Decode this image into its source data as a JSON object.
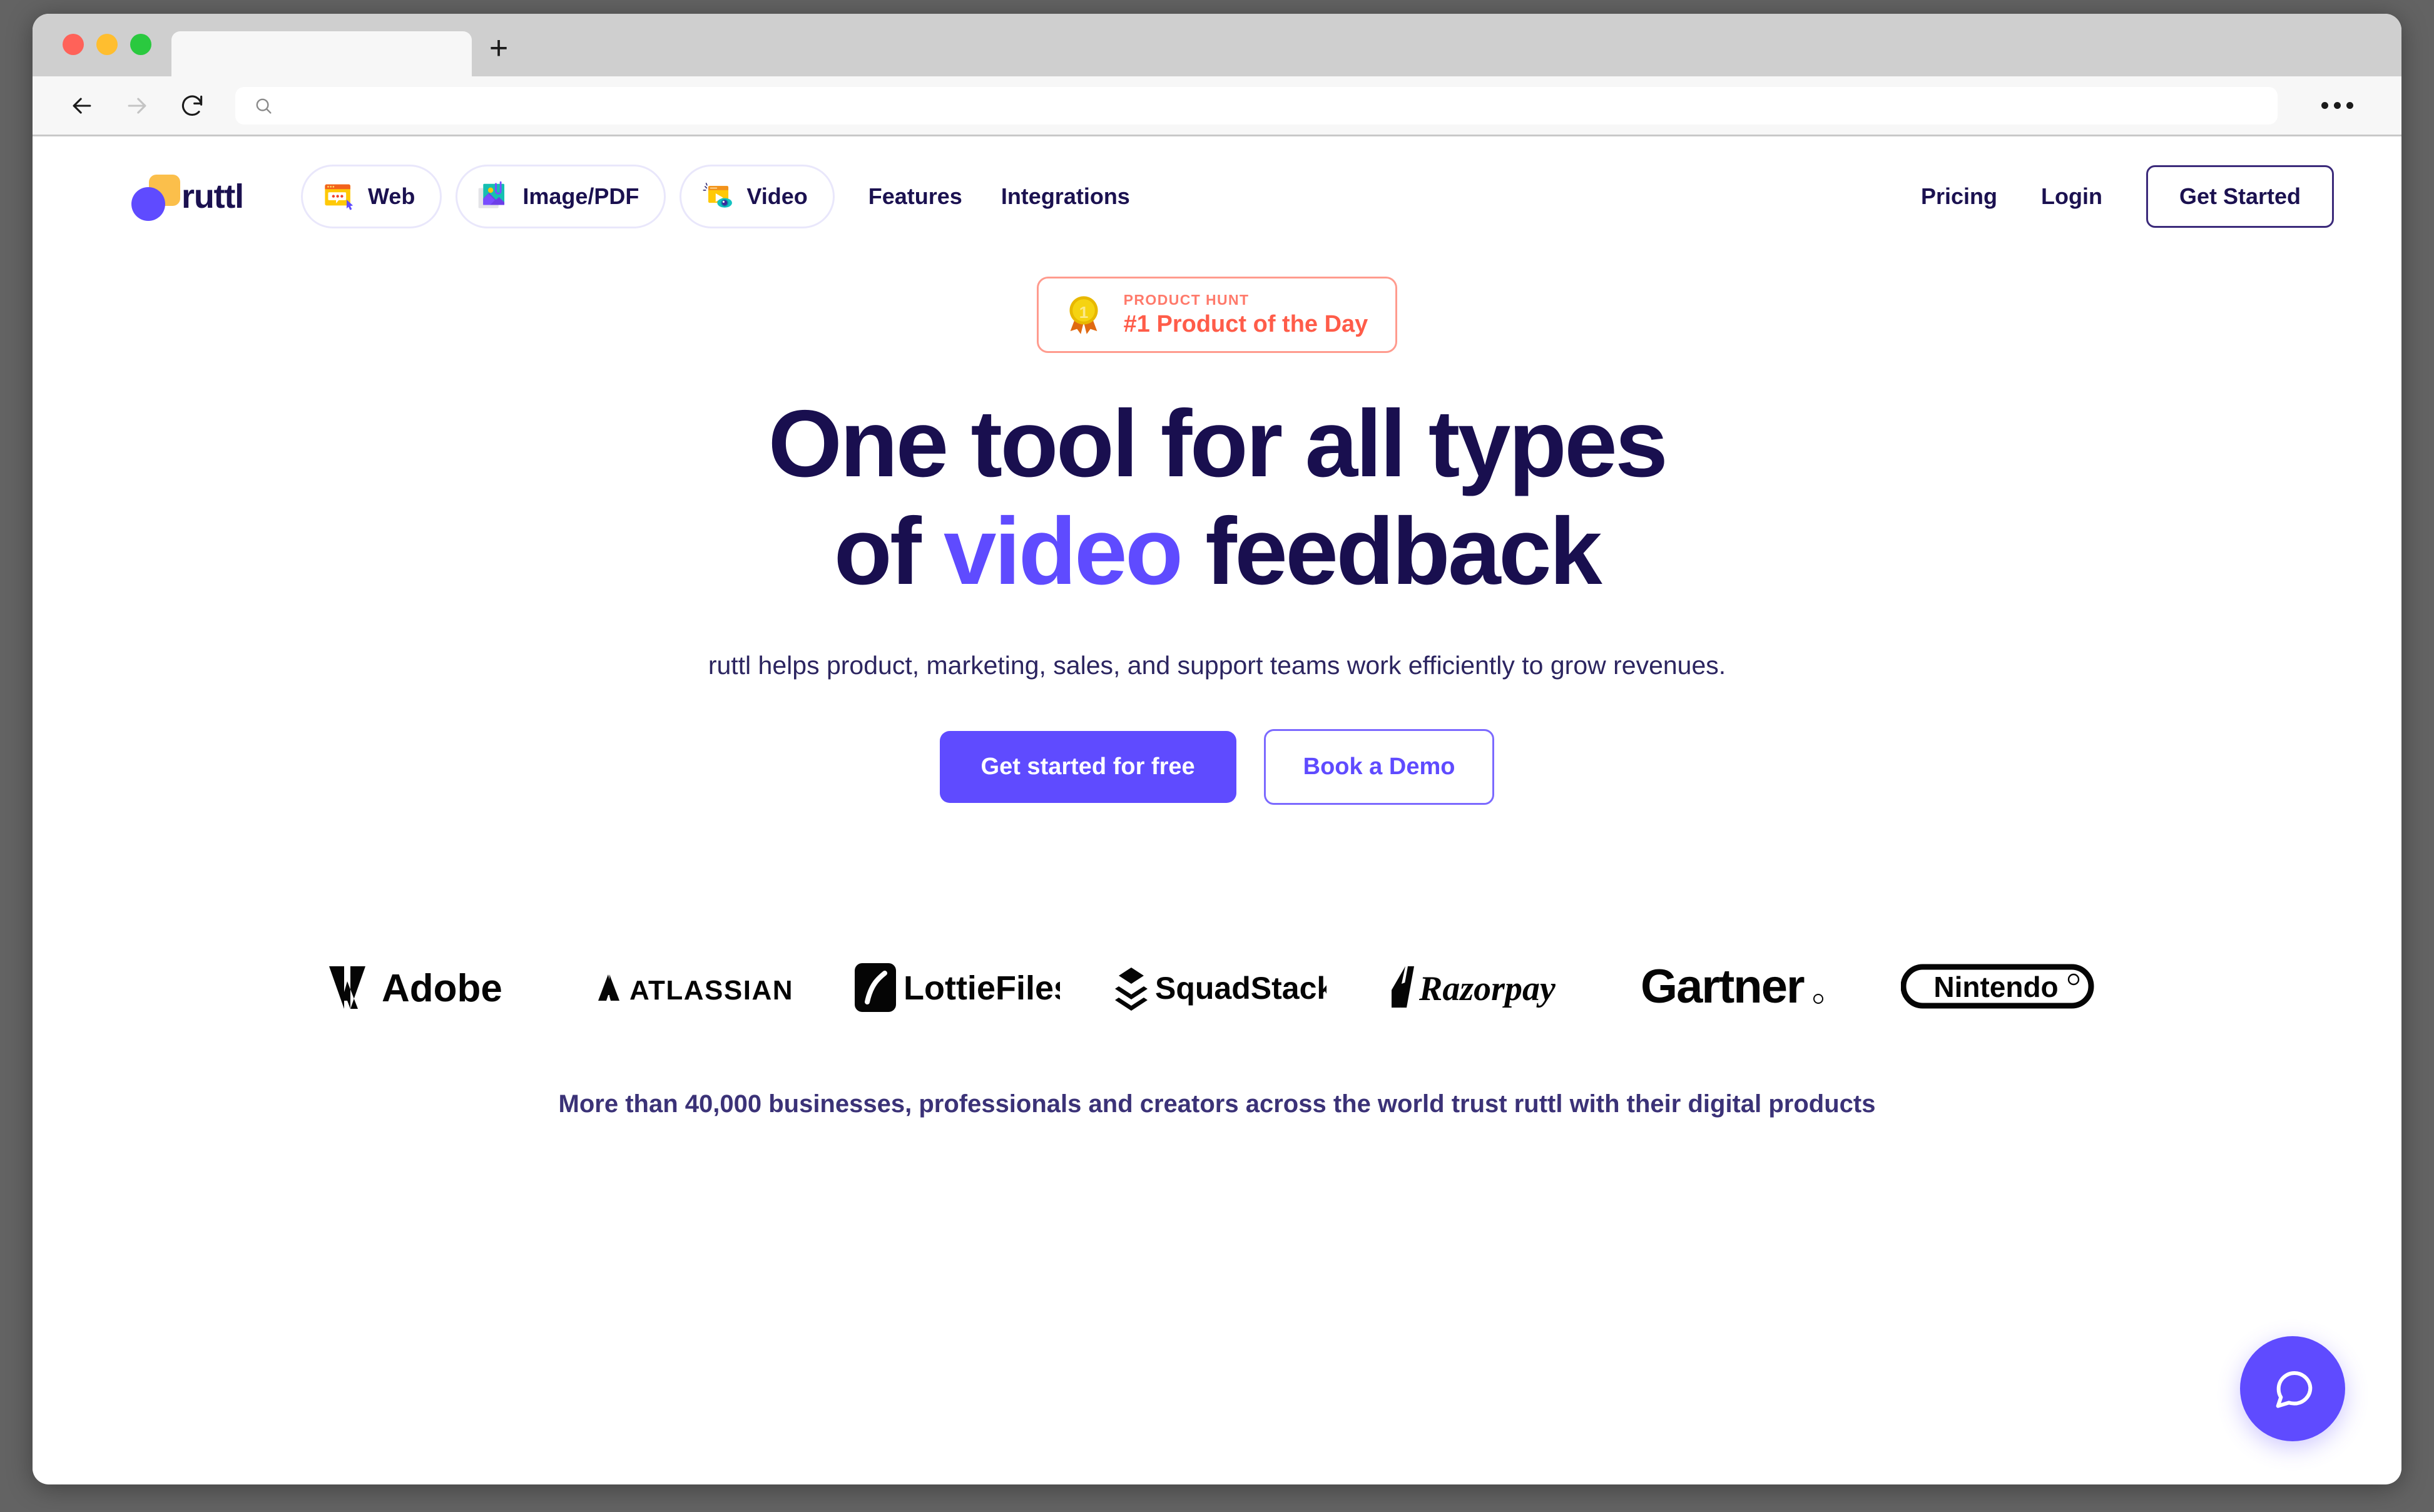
{
  "browser": {
    "tab_title": "",
    "url_value": "",
    "url_placeholder": "",
    "back_icon": "arrow-left-icon",
    "forward_icon": "arrow-right-icon",
    "reload_icon": "reload-icon",
    "search_icon": "search-icon",
    "new_tab_label": "+",
    "overflow_menu_icon": "ellipsis-icon"
  },
  "header": {
    "logo_text": "ruttl",
    "pills": [
      {
        "label": "Web",
        "icon": "web-browser-comment-icon"
      },
      {
        "label": "Image/PDF",
        "icon": "image-pdf-icon"
      },
      {
        "label": "Video",
        "icon": "video-eye-icon"
      }
    ],
    "links": [
      {
        "label": "Features"
      },
      {
        "label": "Integrations"
      }
    ],
    "right_links": [
      {
        "label": "Pricing"
      },
      {
        "label": "Login"
      }
    ],
    "cta_label": "Get Started"
  },
  "hero": {
    "badge": {
      "icon": "gold-medal-icon",
      "kicker": "PRODUCT HUNT",
      "title": "#1 Product of the Day"
    },
    "headline_line1": "One tool for all types",
    "headline_line2_before": "of ",
    "headline_accent": "video",
    "headline_line2_after": " feedback",
    "subhead": "ruttl helps product, marketing, sales, and support teams work efficiently to grow revenues.",
    "primary_cta": "Get started for free",
    "secondary_cta": "Book a Demo"
  },
  "social_proof": {
    "brands": [
      {
        "name": "Adobe"
      },
      {
        "name": "ATLASSIAN"
      },
      {
        "name": "LottieFiles"
      },
      {
        "name": "SquadStack"
      },
      {
        "name": "Razorpay"
      },
      {
        "name": "Gartner"
      },
      {
        "name": "Nintendo"
      }
    ],
    "trust_text": "More than 40,000 businesses, professionals and creators across the world trust ruttl with their digital products"
  },
  "chat": {
    "icon": "chat-bubble-icon"
  },
  "colors": {
    "brand_purple": "#5f4bff",
    "ink": "#190f4f",
    "badge_red": "#ff5c49",
    "logo_yellow": "#fbbf4b"
  }
}
